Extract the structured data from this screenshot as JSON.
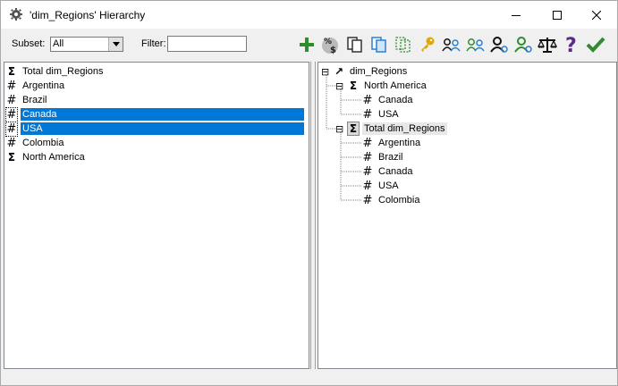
{
  "window": {
    "title": "'dim_Regions' Hierarchy",
    "minimize_glyph": "—",
    "maximize_glyph": "☐",
    "close_glyph": "✕"
  },
  "toolbar": {
    "subset_label": "Subset:",
    "subset_value": "All",
    "filter_label": "Filter:",
    "filter_value": "",
    "tools": [
      {
        "icon": "add-plus-icon",
        "color": "#2e8b2e"
      },
      {
        "icon": "percent-money-icon",
        "color": "#444444"
      },
      {
        "icon": "copy-documents-icon",
        "color": "#333333"
      },
      {
        "icon": "copy-blue-icon",
        "color": "#2a7fd4"
      },
      {
        "icon": "copy-dashed-icon",
        "color": "#2e8b2e"
      },
      {
        "icon": "key-icon",
        "color": "#e0a800"
      },
      {
        "icon": "users-blue-icon",
        "color": "#2a7fd4"
      },
      {
        "icon": "users-green-icon",
        "color": "#2e8b2e"
      },
      {
        "icon": "user-black-icon",
        "color": "#111111"
      },
      {
        "icon": "user-green-icon",
        "color": "#2e8b2e"
      },
      {
        "icon": "scales-icon",
        "color": "#111111"
      },
      {
        "icon": "help-question-icon",
        "color": "#5b2a86"
      },
      {
        "icon": "check-ok-icon",
        "color": "#2e8b2e"
      }
    ]
  },
  "left_list": [
    {
      "symbol": "Σ",
      "label": "Total dim_Regions",
      "selected": false
    },
    {
      "symbol": "#",
      "label": "Argentina",
      "selected": false
    },
    {
      "symbol": "#",
      "label": "Brazil",
      "selected": false
    },
    {
      "symbol": "#",
      "label": "Canada",
      "selected": true
    },
    {
      "symbol": "#",
      "label": "USA",
      "selected": true
    },
    {
      "symbol": "#",
      "label": "Colombia",
      "selected": false
    },
    {
      "symbol": "Σ",
      "label": "North America",
      "selected": false
    }
  ],
  "right_tree": {
    "root": {
      "symbol": "↗",
      "label": "dim_Regions",
      "expand": "⊟"
    },
    "groups": [
      {
        "symbol": "Σ",
        "label": "North America",
        "expand": "⊟",
        "children": [
          "Canada",
          "USA"
        ]
      },
      {
        "symbol": "Σ",
        "label": "Total dim_Regions",
        "expand": "⊟",
        "children": [
          "Argentina",
          "Brazil",
          "Canada",
          "USA",
          "Colombia"
        ]
      }
    ],
    "leaf_symbol": "#"
  },
  "colors": {
    "selection": "#0078d7",
    "accent_green": "#2e8b2e"
  }
}
